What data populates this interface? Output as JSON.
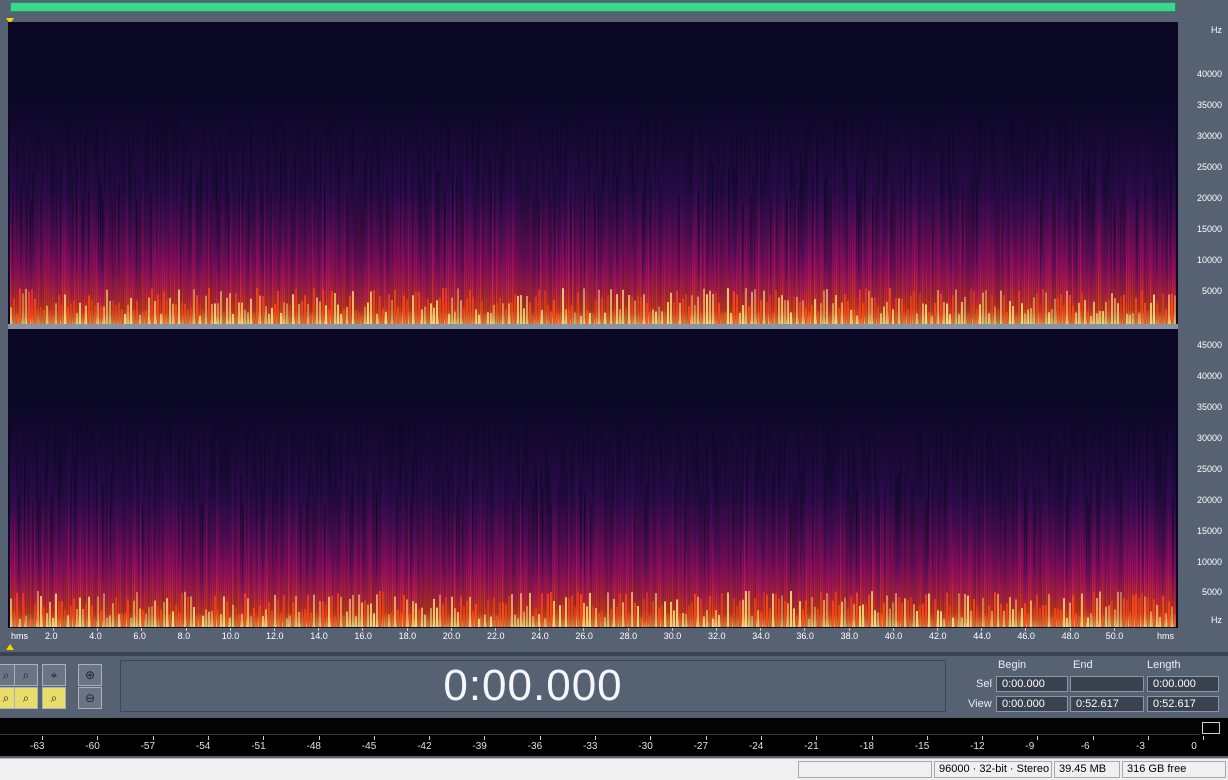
{
  "overview": {
    "bar_color": "#3ed68f"
  },
  "spectrogram": {
    "channel1_freq_labels": [
      "Hz",
      "40000",
      "35000",
      "30000",
      "25000",
      "20000",
      "15000",
      "10000",
      "5000"
    ],
    "channel2_freq_labels": [
      "45000",
      "40000",
      "35000",
      "30000",
      "25000",
      "20000",
      "15000",
      "10000",
      "5000",
      "Hz"
    ],
    "colors": {
      "background": "#0b0826",
      "low": "#3a0c5a",
      "mid": "#c0106a",
      "high": "#ff4a10",
      "peak": "#ffe07a"
    }
  },
  "time_ruler": {
    "left_unit": "hms",
    "right_unit": "hms",
    "ticks": [
      "2.0",
      "4.0",
      "6.0",
      "8.0",
      "10.0",
      "12.0",
      "14.0",
      "16.0",
      "18.0",
      "20.0",
      "22.0",
      "24.0",
      "26.0",
      "28.0",
      "30.0",
      "32.0",
      "34.0",
      "36.0",
      "38.0",
      "40.0",
      "42.0",
      "44.0",
      "46.0",
      "48.0",
      "50.0"
    ]
  },
  "transport": {
    "time": "0:00.000"
  },
  "selection_view": {
    "headers": {
      "begin": "Begin",
      "end": "End",
      "length": "Length"
    },
    "sel": {
      "label": "Sel",
      "begin": "0:00.000",
      "end": "",
      "length": "0:00.000"
    },
    "view": {
      "label": "View",
      "begin": "0:00.000",
      "end": "0:52.617",
      "length": "0:52.617"
    }
  },
  "level_meter": {
    "scale": [
      "-63",
      "-60",
      "-57",
      "-54",
      "-51",
      "-48",
      "-45",
      "-42",
      "-39",
      "-36",
      "-33",
      "-30",
      "-27",
      "-24",
      "-21",
      "-18",
      "-15",
      "-12",
      "-9",
      "-6",
      "-3",
      "0"
    ]
  },
  "status_bar": {
    "format": "96000 · 32-bit · Stereo",
    "size": "39.45 MB",
    "free": "316 GB free"
  },
  "toolbar": {
    "icons": [
      "zoom-in-horizontal-icon",
      "zoom-out-horizontal-icon",
      "zoom-full-icon",
      "zoom-in-vertical-icon",
      "zoom-to-left-icon",
      "zoom-to-right-icon",
      "zoom-selection-icon",
      "zoom-out-vertical-icon"
    ]
  }
}
